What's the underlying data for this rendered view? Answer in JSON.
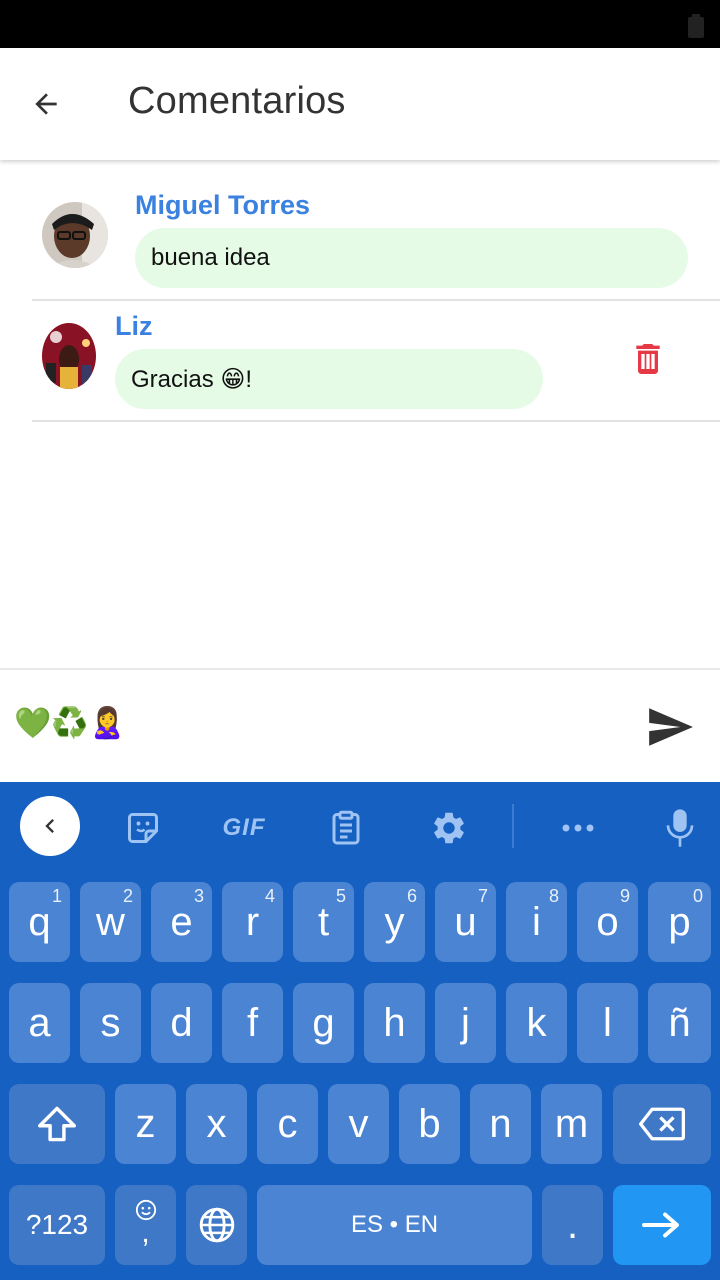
{
  "header": {
    "title": "Comentarios"
  },
  "comments": [
    {
      "author": "Miguel Torres",
      "text": "buena idea",
      "deletable": false
    },
    {
      "author": "Liz",
      "text": "Gracias 😁!",
      "deletable": true
    }
  ],
  "composer": {
    "value": "💚♻️🙎‍♀️"
  },
  "keyboard": {
    "toolbar": {
      "gif_label": "GIF"
    },
    "row1": [
      {
        "label": "q",
        "hint": "1"
      },
      {
        "label": "w",
        "hint": "2"
      },
      {
        "label": "e",
        "hint": "3"
      },
      {
        "label": "r",
        "hint": "4"
      },
      {
        "label": "t",
        "hint": "5"
      },
      {
        "label": "y",
        "hint": "6"
      },
      {
        "label": "u",
        "hint": "7"
      },
      {
        "label": "i",
        "hint": "8"
      },
      {
        "label": "o",
        "hint": "9"
      },
      {
        "label": "p",
        "hint": "0"
      }
    ],
    "row2": [
      "a",
      "s",
      "d",
      "f",
      "g",
      "h",
      "j",
      "k",
      "l",
      "ñ"
    ],
    "row3": [
      "z",
      "x",
      "c",
      "v",
      "b",
      "n",
      "m"
    ],
    "symbols_label": "?123",
    "comma_label": ",",
    "space_label": "ES • EN",
    "period_label": "."
  },
  "colors": {
    "accent": "#3b82e0",
    "bubble": "#e6fbe6",
    "keyboard_bg": "#1560c0",
    "key_bg": "#4a84d3",
    "trash": "#e53945"
  }
}
